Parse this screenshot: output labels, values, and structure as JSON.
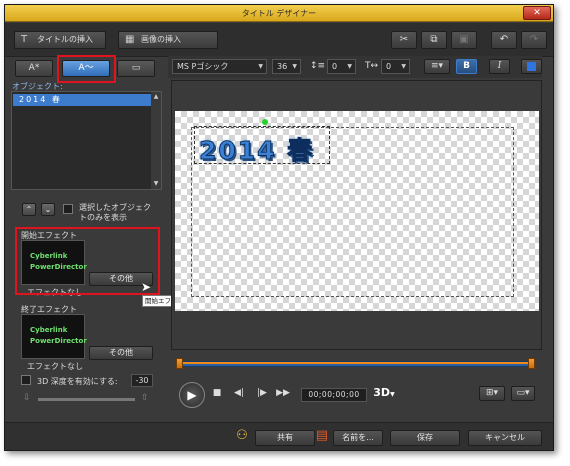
{
  "window": {
    "title": "タイトル デザイナー",
    "close_glyph": "✕"
  },
  "toolbar": {
    "insert_title_icon": "T",
    "insert_title_label": "タイトルの挿入",
    "insert_image_label": "画像の挿入",
    "cut_glyph": "✂",
    "copy_glyph": "⧉",
    "paste_glyph": "▣",
    "undo_glyph": "↶",
    "redo_glyph": "↷"
  },
  "tabs": [
    {
      "label": "A*",
      "icon": "text-style-icon"
    },
    {
      "label": "A〜",
      "icon": "motion-effect-icon"
    },
    {
      "label": "▭",
      "icon": "background-image-icon"
    }
  ],
  "objects": {
    "label": "オブジェクト:",
    "items": [
      "2014 春"
    ],
    "show_selected_only": "選択したオブジェクトのみを表示"
  },
  "start_effect": {
    "label": "開始エフェクト",
    "thumb_line1": "Cyberlink",
    "thumb_line2": "PowerDirector",
    "name": "エフェクトなし",
    "other_button": "その他",
    "tooltip": "開始エフェクトの選択"
  },
  "end_effect": {
    "label": "終了エフェクト",
    "thumb_line1": "Cyberlink",
    "thumb_line2": "PowerDirector",
    "name": "エフェクトなし",
    "other_button": "その他"
  },
  "depth3d": {
    "label": "3D 深度を有効にする:",
    "value": "-30"
  },
  "format": {
    "font": "MS Pゴシック",
    "size": "36",
    "line_spacing": "0",
    "char_spacing": "0",
    "bold": "B",
    "italic": "I"
  },
  "preview": {
    "text": "2014 春"
  },
  "player": {
    "play_glyph": "▶",
    "stop_glyph": "■",
    "prev_glyph": "◀|",
    "next_glyph": "|▶",
    "ffwd_glyph": "▶▶",
    "timecode": "00;00;00;00",
    "mode_3d": "3D"
  },
  "footer": {
    "share_label": "共有",
    "save_as_label": "名前を...",
    "save_label": "保存",
    "cancel_label": "キャンセル"
  },
  "colors": {
    "accent": "#3d7ccd",
    "title_bar": "#e6b935",
    "highlight": "#e0141e"
  }
}
